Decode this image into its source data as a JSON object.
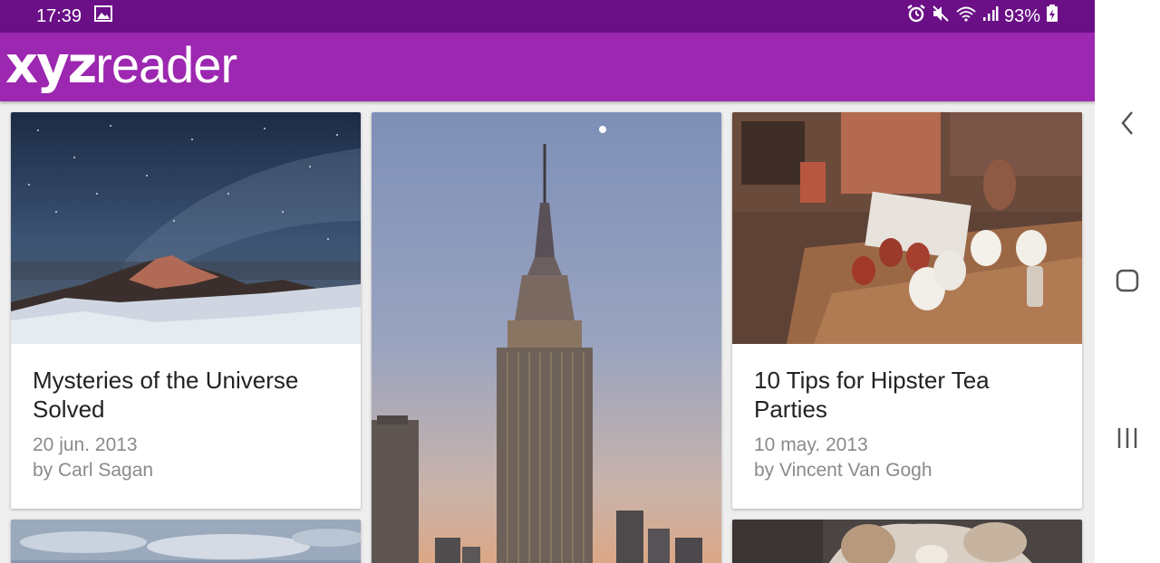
{
  "status_bar": {
    "time": "17:39",
    "battery": "93%",
    "icons": [
      "image-icon",
      "alarm-icon",
      "mute-icon",
      "wifi-icon",
      "signal-icon",
      "battery-icon"
    ]
  },
  "app_bar": {
    "logo_bold": "xyz",
    "logo_light": "reader",
    "color": "#9c27b0",
    "status_color": "#6a0f86"
  },
  "articles": [
    {
      "title": "Mysteries of the Universe Solved",
      "date": "20 jun. 2013",
      "byline": "by Carl Sagan",
      "image": "starry-mountain-photo"
    },
    {
      "title": "",
      "date": "",
      "byline": "",
      "image": "empire-state-building-photo"
    },
    {
      "title": "10 Tips for Hipster Tea Parties",
      "date": "10 may. 2013",
      "byline": "by Vincent Van Gogh",
      "image": "tea-cups-table-photo"
    },
    {
      "image": "cloudy-sky-photo"
    },
    {
      "image": "dog-photo"
    }
  ],
  "navigation": {
    "icons": [
      "back-icon",
      "home-icon",
      "recent-apps-icon"
    ]
  }
}
